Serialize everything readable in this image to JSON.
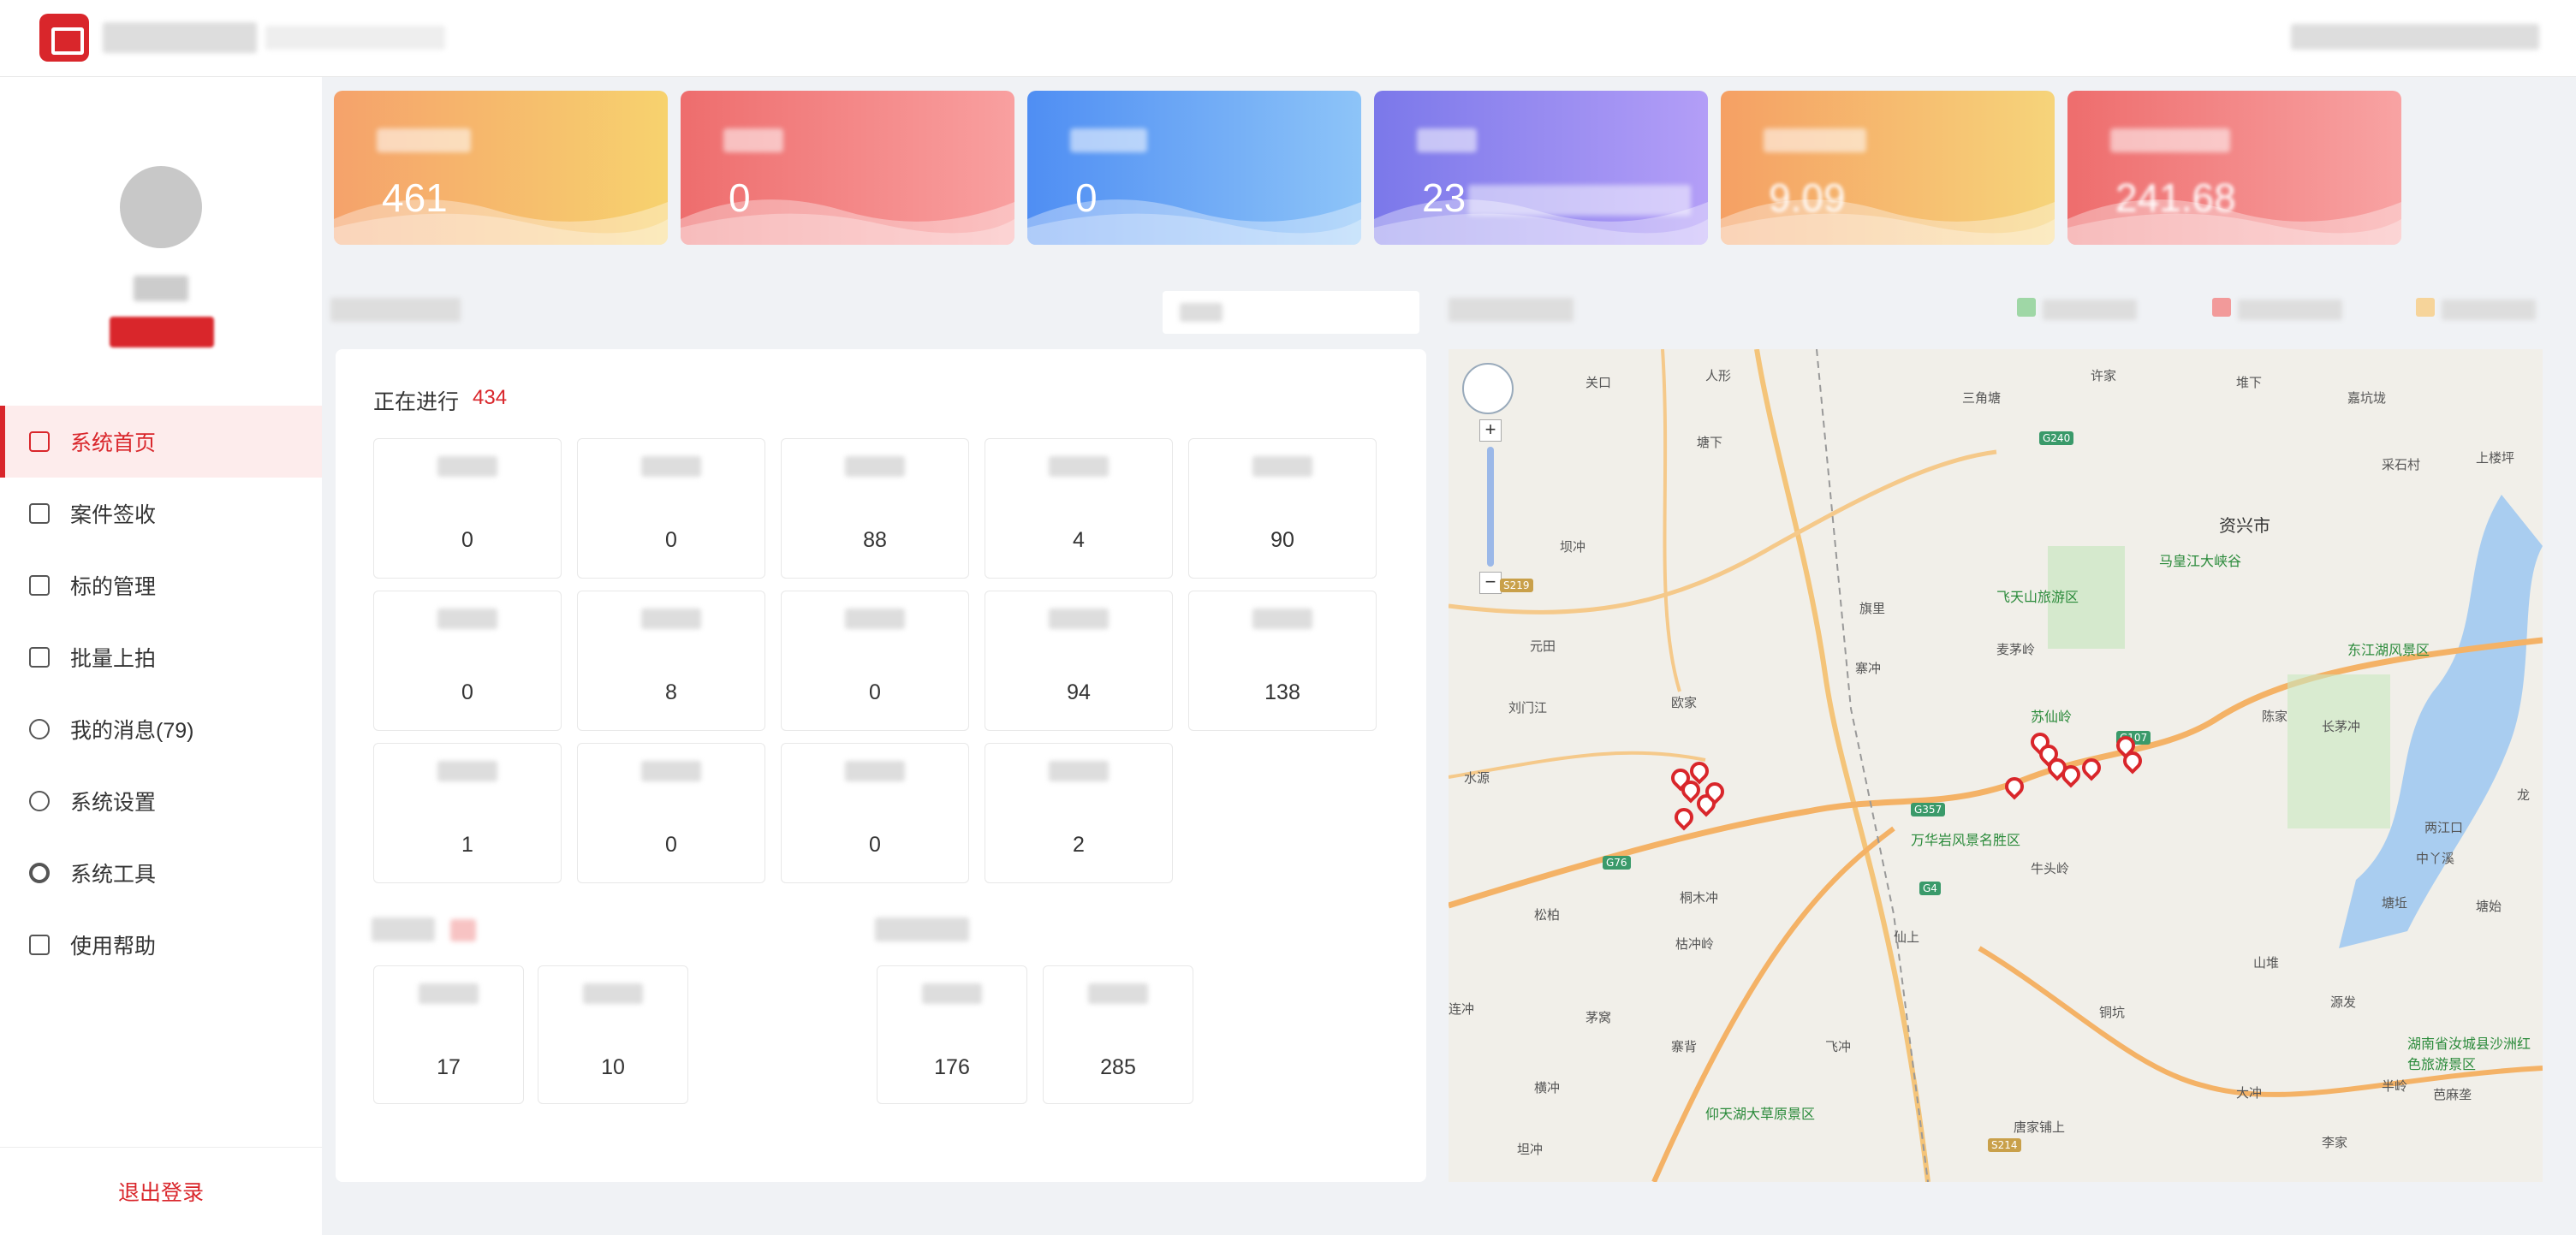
{
  "sidebar": {
    "items": [
      {
        "label": "系统首页",
        "active": true,
        "icon": "home-icon"
      },
      {
        "label": "案件签收",
        "icon": "sign-icon"
      },
      {
        "label": "标的管理",
        "icon": "asset-icon"
      },
      {
        "label": "批量上拍",
        "icon": "upload-icon"
      },
      {
        "label": "我的消息(79)",
        "icon": "message-icon"
      },
      {
        "label": "系统设置",
        "icon": "settings-icon"
      },
      {
        "label": "系统工具",
        "icon": "tool-icon"
      },
      {
        "label": "使用帮助",
        "icon": "help-icon"
      }
    ],
    "logout_label": "退出登录"
  },
  "cards": [
    {
      "value": "461",
      "color_from": "#f5a26b",
      "color_to": "#f7d26e"
    },
    {
      "value": "0",
      "color_from": "#ee6d6d",
      "color_to": "#f9a0a0"
    },
    {
      "value": "0",
      "color_from": "#4f8ef3",
      "color_to": "#8dc4f8"
    },
    {
      "value": "23",
      "color_from": "#7b78ea",
      "color_to": "#b39ef7"
    },
    {
      "value": "9.09",
      "color_from": "#f5a064",
      "color_to": "#f6d47a"
    },
    {
      "value": "241.68",
      "color_from": "#ee6d6d",
      "color_to": "#f8a3a3"
    }
  ],
  "ongoing": {
    "title": "正在进行",
    "count": "434",
    "values": [
      "0",
      "0",
      "88",
      "4",
      "90",
      "0",
      "8",
      "0",
      "94",
      "138",
      "1",
      "0",
      "0",
      "2"
    ]
  },
  "group_a": {
    "values": [
      "17",
      "10"
    ]
  },
  "group_b": {
    "values": [
      "176",
      "285"
    ]
  },
  "map": {
    "places": [
      {
        "name": "关口"
      },
      {
        "name": "人形"
      },
      {
        "name": "三角塘"
      },
      {
        "name": "许家"
      },
      {
        "name": "堆下"
      },
      {
        "name": "嘉坑垅"
      },
      {
        "name": "塘下"
      },
      {
        "name": "采石村"
      },
      {
        "name": "上楼坪"
      },
      {
        "name": "坝冲"
      },
      {
        "name": "资兴市"
      },
      {
        "name": "旗里"
      },
      {
        "name": "元田"
      },
      {
        "name": "寨冲"
      },
      {
        "name": "麦茅岭"
      },
      {
        "name": "刘门江"
      },
      {
        "name": "欧家"
      },
      {
        "name": "陈家"
      },
      {
        "name": "长茅冲"
      },
      {
        "name": "龙"
      },
      {
        "name": "水源"
      },
      {
        "name": "两江口"
      },
      {
        "name": "中丫溪"
      },
      {
        "name": "牛头岭"
      },
      {
        "name": "松柏"
      },
      {
        "name": "桐木冲"
      },
      {
        "name": "塘坵"
      },
      {
        "name": "塘始"
      },
      {
        "name": "枯冲岭"
      },
      {
        "name": "仙上"
      },
      {
        "name": "山堆"
      },
      {
        "name": "连冲"
      },
      {
        "name": "茅窝"
      },
      {
        "name": "寨背"
      },
      {
        "name": "飞冲"
      },
      {
        "name": "铜坑"
      },
      {
        "name": "源发"
      },
      {
        "name": "横冲"
      },
      {
        "name": "半岭"
      },
      {
        "name": "大冲"
      },
      {
        "name": "芭麻垄"
      },
      {
        "name": "坦冲"
      },
      {
        "name": "唐家铺上"
      },
      {
        "name": "李家"
      }
    ],
    "pois": [
      {
        "name": "马皇江大峡谷"
      },
      {
        "name": "飞天山旅游区"
      },
      {
        "name": "东江湖风景区"
      },
      {
        "name": "苏仙岭"
      },
      {
        "name": "万华岩风景名胜区"
      },
      {
        "name": "仰天湖大草原景区"
      },
      {
        "name": "湖南省汝城县沙洲红色旅游景区"
      }
    ],
    "roads": [
      "G240",
      "G107",
      "G357",
      "G76",
      "G4",
      "S214",
      "S219"
    ],
    "marker_color": "#d9262b"
  }
}
